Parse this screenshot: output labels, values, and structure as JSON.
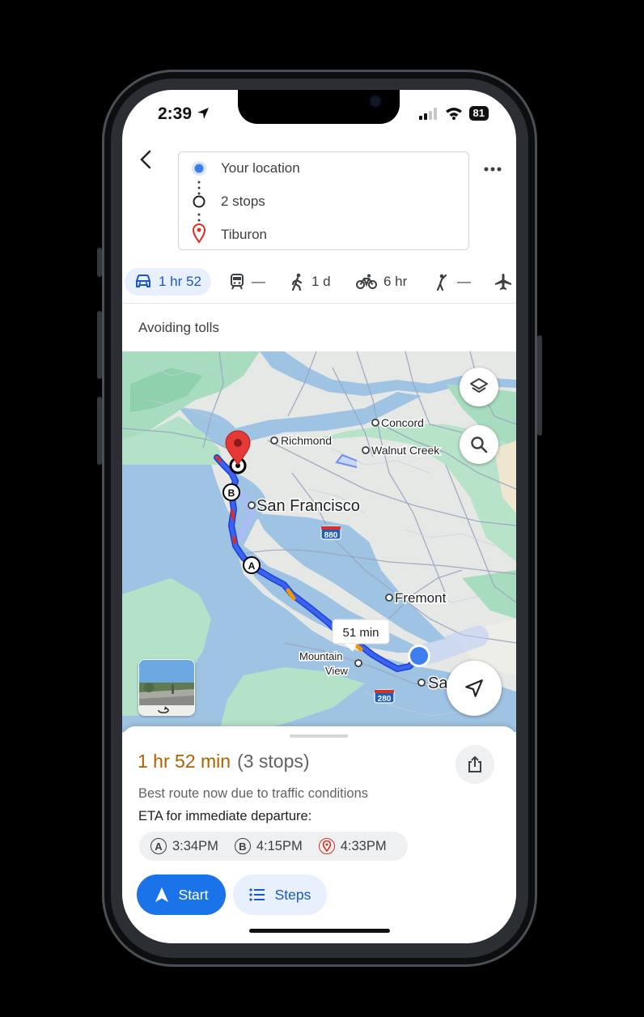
{
  "status_bar": {
    "time": "2:39",
    "battery": "81"
  },
  "route": {
    "origin": "Your location",
    "middle": "2 stops",
    "destination": "Tiburon"
  },
  "modes": [
    {
      "name": "drive",
      "label": "1 hr 52",
      "icon": "car-icon",
      "active": true
    },
    {
      "name": "transit",
      "label": "—",
      "icon": "train-icon"
    },
    {
      "name": "walk",
      "label": "1 d",
      "icon": "walk-icon"
    },
    {
      "name": "bike",
      "label": "6 hr",
      "icon": "bike-icon"
    },
    {
      "name": "rideshare",
      "label": "—",
      "icon": "hail-icon"
    },
    {
      "name": "flight",
      "label": "",
      "icon": "plane-icon"
    }
  ],
  "options_text": "Avoiding tolls",
  "map": {
    "labels": {
      "concord": "Concord",
      "richmond": "Richmond",
      "walnut_creek": "Walnut Creek",
      "san_francisco": "San Francisco",
      "fremont": "Fremont",
      "mountain": "Mountain",
      "view": "View",
      "san_jose_partial": "Sa",
      "hwy_880": "880",
      "hwy_280": "280"
    },
    "duration_callout": "51 min",
    "waypoint_a": "A",
    "waypoint_b": "B"
  },
  "sheet": {
    "duration": "1 hr 52 min",
    "stops": "(3 stops)",
    "best_route": "Best route now due to traffic conditions",
    "eta_label": "ETA for immediate departure:",
    "eta": [
      {
        "marker": "A",
        "time": "3:34PM"
      },
      {
        "marker": "B",
        "time": "4:15PM"
      },
      {
        "marker": "pin",
        "time": "4:33PM"
      }
    ],
    "start_label": "Start",
    "steps_label": "Steps"
  },
  "colors": {
    "accent": "#1a73e8",
    "route": "#2a4ff0",
    "traffic_slow": "#f29900",
    "traffic_heavy": "#d93025",
    "duration_text": "#b06000"
  }
}
